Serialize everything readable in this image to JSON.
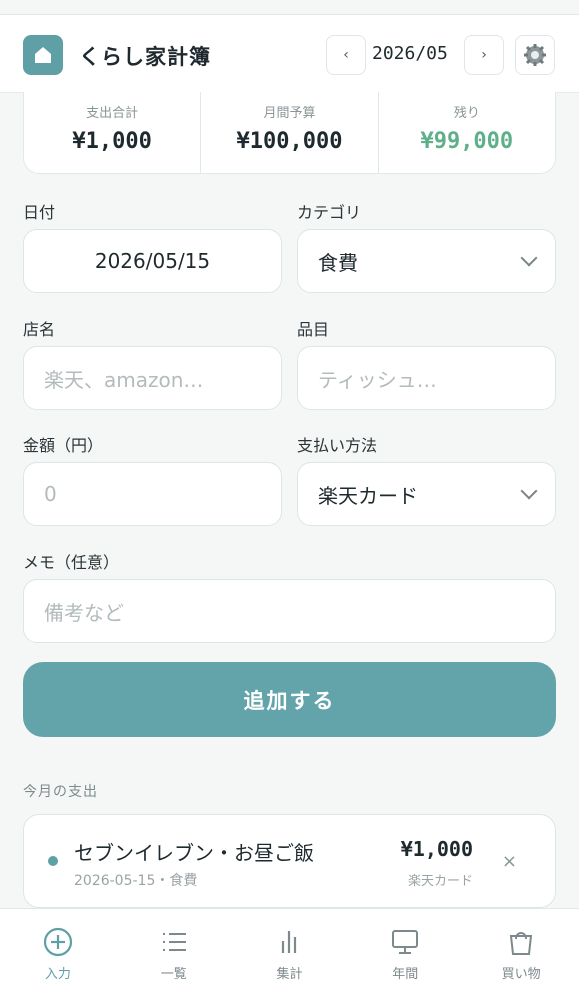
{
  "app": {
    "title": "くらし家計簿"
  },
  "header": {
    "prev_label": "‹",
    "next_label": "›",
    "month": "2026/05"
  },
  "summary": {
    "total_label": "支出合計",
    "total_value": "¥1,000",
    "budget_label": "月間予算",
    "budget_value": "¥100,000",
    "remaining_label": "残り",
    "remaining_value": "¥99,000"
  },
  "form": {
    "date_label": "日付",
    "date_value": "2026/05/15",
    "category_label": "カテゴリ",
    "category_value": "食費",
    "store_label": "店名",
    "store_placeholder": "楽天、amazon…",
    "item_label": "品目",
    "item_placeholder": "ティッシュ…",
    "amount_label": "金額（円）",
    "amount_placeholder": "0",
    "payment_label": "支払い方法",
    "payment_value": "楽天カード",
    "memo_label": "メモ（任意）",
    "memo_placeholder": "備考など",
    "submit_label": "追加する"
  },
  "expenses": {
    "section_title": "今月の支出",
    "items": [
      {
        "title": "セブンイレブン・お昼ご飯",
        "meta": "2026-05-15・食費",
        "amount": "¥1,000",
        "payment": "楽天カード",
        "delete": "×"
      }
    ]
  },
  "tabs": [
    {
      "label": "入力",
      "icon": "plus-circle-icon"
    },
    {
      "label": "一覧",
      "icon": "list-icon"
    },
    {
      "label": "集計",
      "icon": "bar-chart-icon"
    },
    {
      "label": "年間",
      "icon": "monitor-icon"
    },
    {
      "label": "買い物",
      "icon": "shopping-bag-icon"
    }
  ],
  "colors": {
    "accent": "#63a4ab",
    "positive": "#5fb08a"
  }
}
